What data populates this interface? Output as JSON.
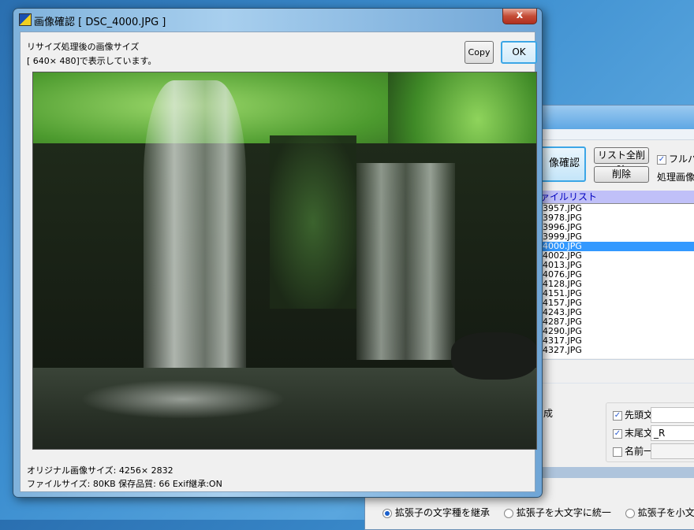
{
  "background_window": {
    "image_check_button": "像確認",
    "clear_list_button": "リスト全削除",
    "delete_button": "削除",
    "fullpath_checkbox": {
      "label": "フルパス",
      "checked": true
    },
    "processed_image_label": "処理画像",
    "file_list": {
      "header": "ァイルリスト",
      "items": [
        "3957.JPG",
        "3978.JPG",
        "3996.JPG",
        "3999.JPG",
        "4000.JPG",
        "4002.JPG",
        "4013.JPG",
        "4076.JPG",
        "4128.JPG",
        "4151.JPG",
        "4157.JPG",
        "4243.JPG",
        "4287.JPG",
        "4290.JPG",
        "4317.JPG",
        "4327.JPG"
      ],
      "selected_index": 4
    },
    "partial_label": "成",
    "prefix": {
      "label": "先頭文字を付加",
      "checked": true,
      "value": ""
    },
    "suffix": {
      "label": "末尾文字を付加",
      "checked": true,
      "value": "_R"
    },
    "rename": {
      "label": "名前一括変換",
      "checked": false,
      "value": ""
    },
    "extension_options": [
      {
        "label": "拡張子の文字種を継承",
        "selected": true
      },
      {
        "label": "拡張子を大文字に統一",
        "selected": false
      },
      {
        "label": "拡張子を小文字に",
        "selected": false
      }
    ]
  },
  "dialog": {
    "title": "画像確認 [ DSC_4000.JPG ]",
    "close_label": "x",
    "info_line1": "リサイズ処理後の画像サイズ",
    "info_line2": "[ 640× 480]で表示しています。",
    "copy_button": "Copy",
    "ok_button": "OK",
    "original_size": "オリジナル画像サイズ: 4256× 2832",
    "file_info": "ファイルサイズ: 80KB 保存品質: 66 Exif継承:ON"
  }
}
